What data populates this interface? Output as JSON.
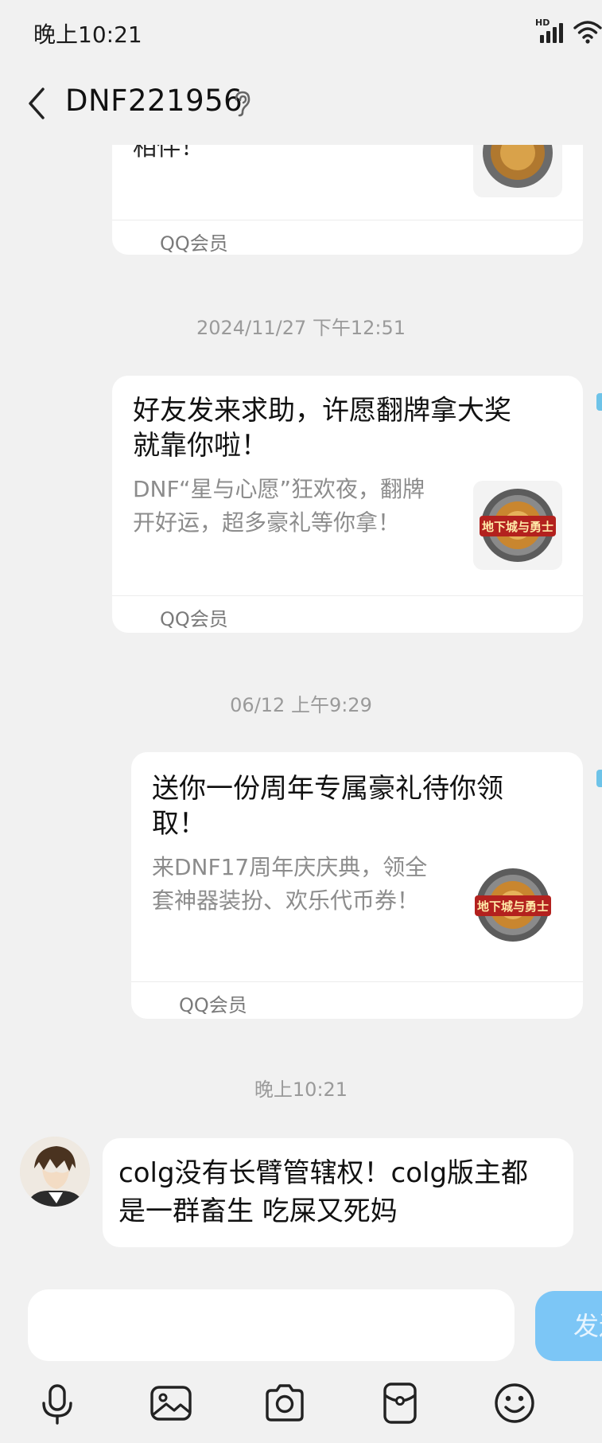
{
  "status_bar": {
    "time": "晚上10:21",
    "network_badge": "HD",
    "icons": [
      "signal-icon",
      "wifi-icon"
    ]
  },
  "header": {
    "title": "DNF221956",
    "back_icon": "chevron-left-icon",
    "ear_icon": "ear-icon"
  },
  "messages": {
    "card0": {
      "partial_text": "相伴！",
      "source": "QQ会员"
    },
    "time1": "2024/11/27 下午12:51",
    "card1": {
      "title_line1": "好友发来求助，许愿翻牌拿大奖",
      "title_line2": "就靠你啦！",
      "desc_line1": "DNF“星与心愿”狂欢夜，翻牌",
      "desc_line2": "开好运，超多豪礼等你拿！",
      "source": "QQ会员",
      "thumb_text": "地下城与勇士"
    },
    "time2": "06/12 上午9:29",
    "card2": {
      "title_line1": "送你一份周年专属豪礼待你领",
      "title_line2": "取！",
      "desc_line1": "来DNF17周年庆庆典，领全",
      "desc_line2": "套神器装扮、欢乐代币券！",
      "source": "QQ会员",
      "thumb_text": "地下城与勇士"
    },
    "time3": "晚上10:21",
    "user_message": {
      "line1": "colg没有长臂管辖权！colg版主都",
      "line2": "是一群畜生 吃屎又死妈"
    }
  },
  "input_bar": {
    "input_value": "",
    "send_label": "发送",
    "tools": [
      "microphone-icon",
      "image-icon",
      "camera-icon",
      "red-packet-icon",
      "emoji-icon"
    ]
  },
  "colors": {
    "background": "#f1f1f1",
    "card": "#ffffff",
    "send_button": "#7cc6f6",
    "muted_text": "#8c8c8c"
  }
}
